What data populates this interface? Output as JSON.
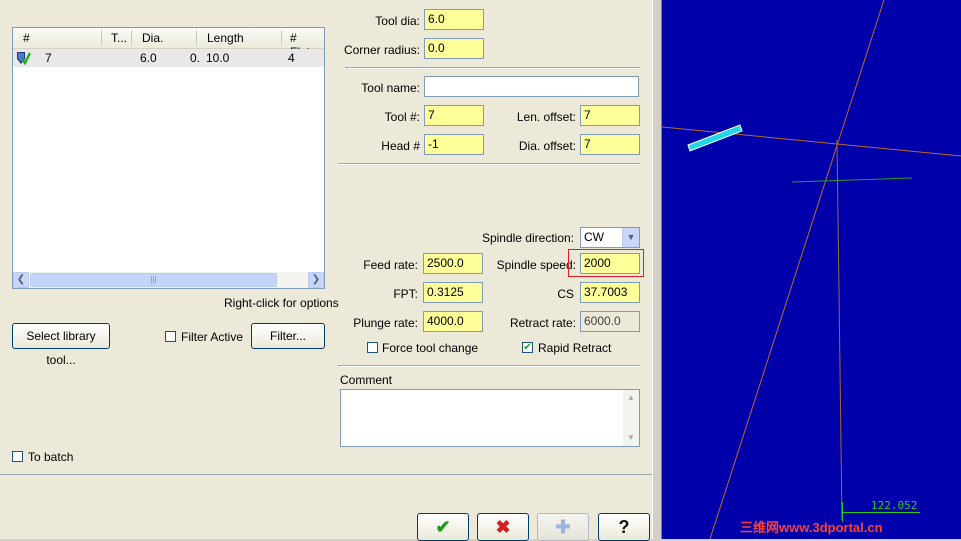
{
  "tool_list": {
    "columns": [
      "#",
      "T...",
      "Dia.",
      "Length",
      "# Flute"
    ],
    "rows": [
      {
        "num": "7",
        "dia": "6.0",
        "extra": "0.",
        "length": "10.0",
        "flutes": "4"
      }
    ],
    "right_click_hint": "Right-click for options"
  },
  "library": {
    "select_button": "Select library tool...",
    "filter_active_label": "Filter Active",
    "filter_button": "Filter...",
    "to_batch_label": "To batch"
  },
  "tool_geometry": {
    "tool_dia_label": "Tool dia:",
    "tool_dia": "6.0",
    "corner_radius_label": "Corner radius:",
    "corner_radius": "0.0"
  },
  "tool_info": {
    "tool_name_label": "Tool name:",
    "tool_name": "",
    "tool_num_label": "Tool #:",
    "tool_num": "7",
    "len_offset_label": "Len. offset:",
    "len_offset": "7",
    "head_label": "Head #",
    "head": "-1",
    "dia_offset_label": "Dia. offset:",
    "dia_offset": "7"
  },
  "cutting": {
    "spindle_direction_label": "Spindle direction:",
    "spindle_direction": "CW",
    "feed_rate_label": "Feed rate:",
    "feed_rate": "2500.0",
    "spindle_speed_label": "Spindle speed:",
    "spindle_speed": "2000",
    "fpt_label": "FPT:",
    "fpt": "0.3125",
    "cs_label": "CS",
    "cs": "37.7003",
    "plunge_rate_label": "Plunge rate:",
    "plunge_rate": "4000.0",
    "retract_rate_label": "Retract rate:",
    "retract_rate": "6000.0",
    "force_tool_change_label": "Force tool change",
    "rapid_retract_label": "Rapid Retract"
  },
  "comment": {
    "label": "Comment",
    "value": ""
  },
  "viewport": {
    "scale_readout": "122.052",
    "watermark": "三维网www.3dportal.cn"
  },
  "colors": {
    "viewport_bg": "#0000aa",
    "field_bg": "#ffff99",
    "highlight": "#e02020",
    "ok_green": "#1f9a1f",
    "cancel_red": "#d42020"
  },
  "icons": {
    "ok": "check-icon",
    "cancel": "x-icon",
    "add": "plus-icon",
    "help": "question-icon"
  }
}
